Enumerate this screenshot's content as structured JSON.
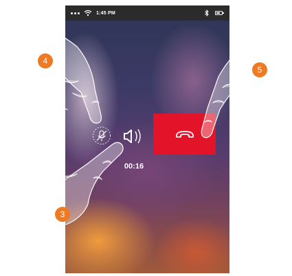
{
  "status_bar": {
    "time": "1:45 PM",
    "battery_level": 0.7,
    "icons": [
      "signal-dots-icon",
      "wifi-icon",
      "bluetooth-icon",
      "battery-icon"
    ]
  },
  "call": {
    "timer": "00:16",
    "controls": [
      {
        "name": "microphone-muted",
        "icon": "microphone-off-icon",
        "state": "muted"
      },
      {
        "name": "speaker",
        "icon": "speaker-icon",
        "state": "on"
      },
      {
        "name": "end-call",
        "icon": "hang-up-icon"
      }
    ]
  },
  "callouts": [
    "4",
    "5",
    "3"
  ],
  "colors": {
    "end_call": "#e3142a",
    "callout": "#ee7a24",
    "status_bar": "#2b2b2b"
  }
}
